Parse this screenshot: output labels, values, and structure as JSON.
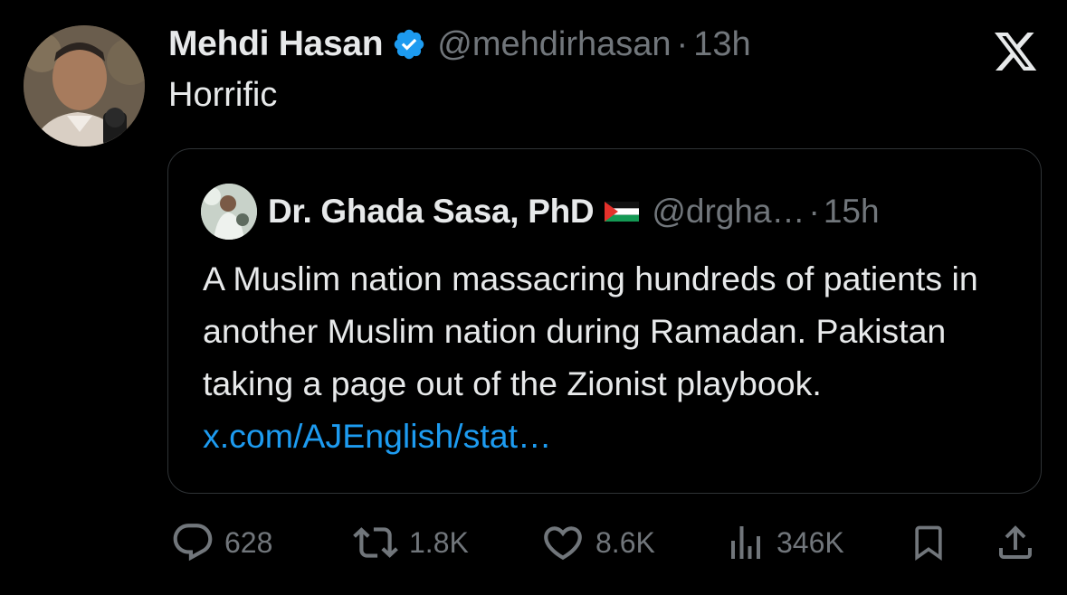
{
  "author": {
    "name": "Mehdi Hasan",
    "handle": "@mehdirhasan",
    "separator": "·",
    "time": "13h",
    "verified": true
  },
  "tweet": {
    "text": "Horrific"
  },
  "quoted": {
    "name": "Dr. Ghada Sasa, PhD",
    "flag": "palestine-flag",
    "handle": "@drgha…",
    "separator": "·",
    "time": "15h",
    "text": "A Muslim nation massacring hundreds of patients in another Muslim nation during Ramadan. Pakistan taking a page out of the Zionist playbook. ",
    "link": "x.com/AJEnglish/stat…"
  },
  "actions": {
    "replies": "628",
    "reposts": "1.8K",
    "likes": "8.6K",
    "views": "346K"
  },
  "icons": [
    "x-logo-icon",
    "verified-icon",
    "reply-icon",
    "repost-icon",
    "like-icon",
    "views-icon",
    "bookmark-icon",
    "share-icon"
  ],
  "colors": {
    "background": "#000000",
    "text": "#e7e9ea",
    "muted": "#71767b",
    "link": "#1d9bf0",
    "verified": "#1d9bf0",
    "border": "#2f3336"
  }
}
